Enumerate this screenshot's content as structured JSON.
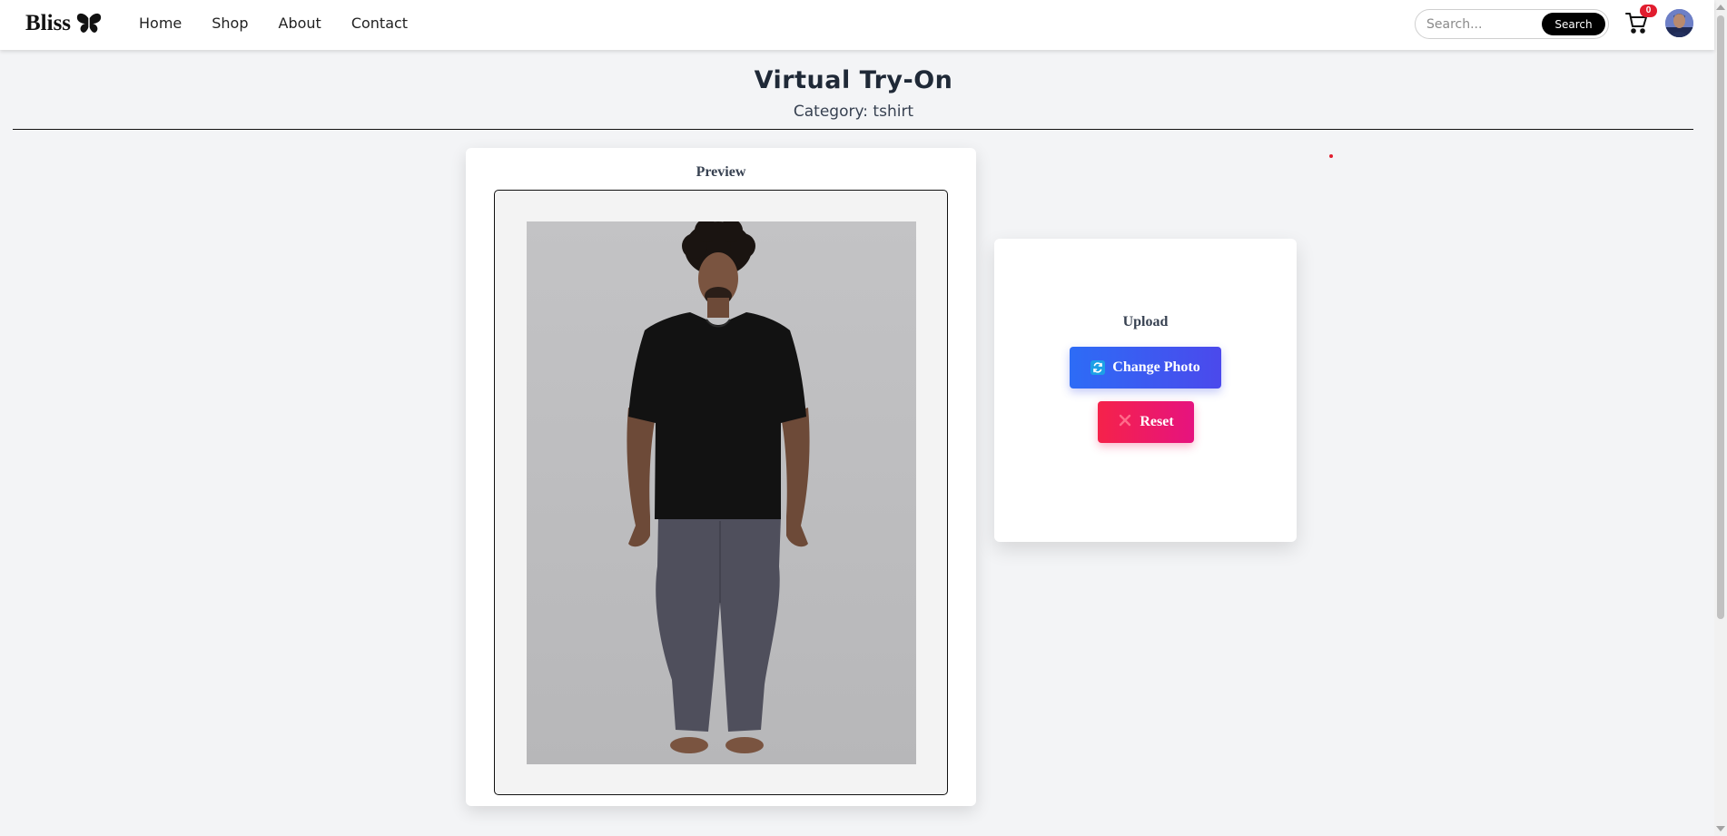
{
  "navbar": {
    "brand": "Bliss",
    "brand_icon": "butterfly-icon",
    "links": [
      "Home",
      "Shop",
      "About",
      "Contact"
    ],
    "search": {
      "placeholder": "Search...",
      "button": "Search"
    },
    "cart": {
      "icon": "cart-icon",
      "count": "0"
    },
    "avatar_icon": "user-avatar"
  },
  "page": {
    "title": "Virtual Try-On",
    "category_line": "Category: tshirt"
  },
  "preview": {
    "title": "Preview",
    "image_alt": "Model wearing a black t-shirt and grey trousers"
  },
  "upload": {
    "title": "Upload",
    "change_button": "Change Photo",
    "change_icon": "refresh-icon",
    "reset_button": "Reset",
    "reset_icon": "close-icon"
  },
  "colors": {
    "page_bg": "#f3f4f6",
    "change_gradient": [
      "#2d6cf6",
      "#4b49ec"
    ],
    "reset_gradient": [
      "#f5224a",
      "#e6137f"
    ],
    "badge": "#e11d2e"
  }
}
